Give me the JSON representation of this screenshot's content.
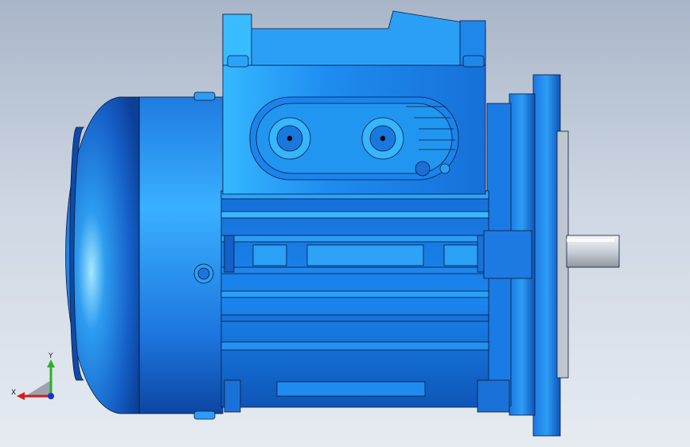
{
  "view": {
    "background_top": "#a9b6c9",
    "background_bottom": "#e6ebf1",
    "model_color": "#1a7ee6",
    "model_dark": "#0a3d9a",
    "model_light": "#7cd6ff",
    "outline_color": "#0b1a3a",
    "shaft_color": "#d8dde4"
  },
  "triad": {
    "x_label": "X",
    "y_label": "Y",
    "x_color": "#d41a1a",
    "y_color": "#2cae2c",
    "z_color": "#1a2fd4"
  }
}
